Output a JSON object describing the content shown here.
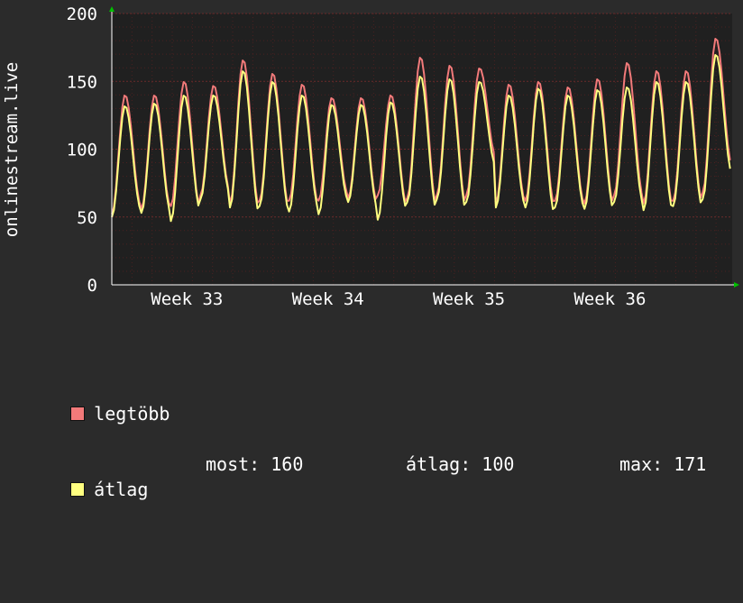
{
  "chart_data": {
    "type": "line",
    "ylabel": "onlinestream.live",
    "ylim": [
      0,
      200
    ],
    "yticks": [
      0,
      50,
      100,
      150,
      200
    ],
    "xticks": [
      "Week 33",
      "Week 34",
      "Week 35",
      "Week 36"
    ],
    "grid": true,
    "colors": {
      "background": "#2b2b2b",
      "plot": "#202020",
      "grid": "#4a2020",
      "max_series": "#f27a7a",
      "avg_series": "#ffff80",
      "axis_arrow": "#00c000"
    },
    "series": [
      {
        "name": "legtöbb",
        "color": "#f27a7a",
        "days": [
          [
            52,
            140,
            58
          ],
          [
            56,
            140,
            57
          ],
          [
            58,
            150,
            56
          ],
          [
            66,
            147,
            70
          ],
          [
            60,
            166,
            56
          ],
          [
            62,
            156,
            58
          ],
          [
            62,
            148,
            60
          ],
          [
            62,
            138,
            67
          ],
          [
            64,
            138,
            60
          ],
          [
            66,
            140,
            58
          ],
          [
            64,
            168,
            58
          ],
          [
            66,
            162,
            58
          ],
          [
            66,
            160,
            95
          ],
          [
            60,
            148,
            62
          ],
          [
            62,
            150,
            58
          ],
          [
            62,
            146,
            60
          ],
          [
            60,
            152,
            58
          ],
          [
            66,
            164,
            64
          ],
          [
            60,
            158,
            58
          ],
          [
            62,
            158,
            60
          ],
          [
            68,
            182,
            88
          ]
        ]
      },
      {
        "name": "átlag",
        "color": "#ffff80",
        "days": [
          [
            50,
            132,
            55
          ],
          [
            53,
            134,
            54
          ],
          [
            47,
            140,
            55
          ],
          [
            63,
            140,
            68
          ],
          [
            57,
            158,
            52
          ],
          [
            58,
            150,
            55
          ],
          [
            54,
            140,
            57
          ],
          [
            52,
            133,
            63
          ],
          [
            61,
            133,
            57
          ],
          [
            48,
            135,
            55
          ],
          [
            61,
            154,
            55
          ],
          [
            63,
            152,
            55
          ],
          [
            61,
            150,
            88
          ],
          [
            57,
            140,
            59
          ],
          [
            57,
            145,
            52
          ],
          [
            57,
            140,
            57
          ],
          [
            56,
            144,
            55
          ],
          [
            61,
            146,
            60
          ],
          [
            55,
            150,
            55
          ],
          [
            58,
            150,
            57
          ],
          [
            63,
            170,
            82
          ]
        ]
      }
    ],
    "legend": {
      "max_label": "legtöbb",
      "avg_label": "átlag",
      "now_text": "most: 160",
      "avg_text": "átlag: 100",
      "max_text": "max: 171"
    }
  }
}
